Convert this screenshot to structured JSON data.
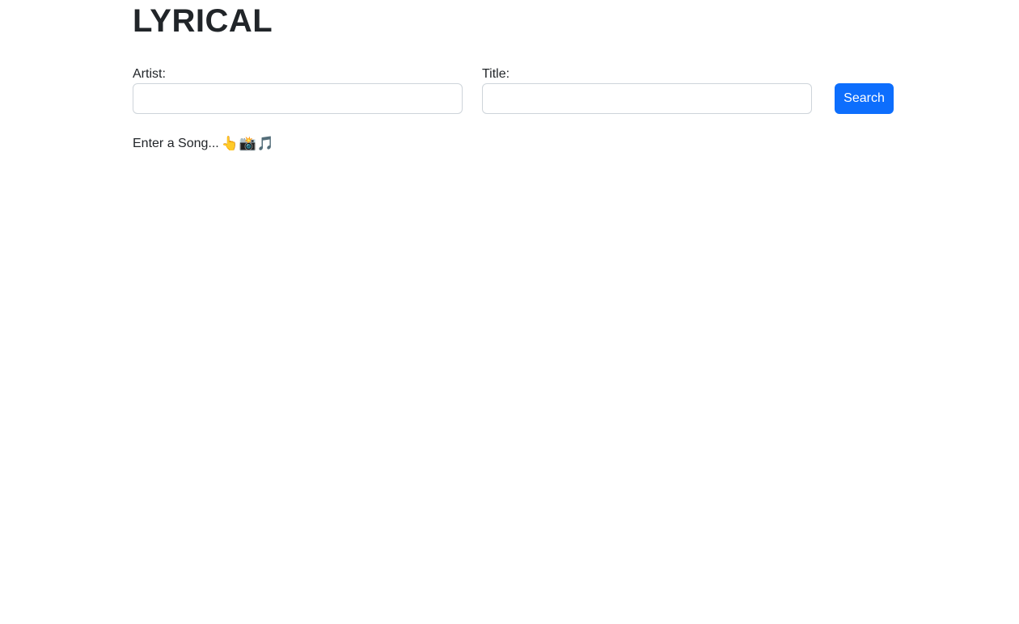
{
  "header": {
    "title": "LYRICAL"
  },
  "form": {
    "artist_label": "Artist:",
    "artist_value": "",
    "artist_placeholder": "",
    "title_label": "Title:",
    "title_value": "",
    "title_placeholder": "",
    "search_label": "Search"
  },
  "status": {
    "prompt_text": "Enter a Song...",
    "emojis": {
      "pointing": "👆",
      "camera": "📸",
      "music": "🎵"
    }
  },
  "colors": {
    "accent": "#0d6efd",
    "text": "#212529",
    "input_border": "#ced4da",
    "background": "#ffffff"
  },
  "icons": [
    "pointing-hand-icon",
    "camera-flash-icon",
    "music-notes-icon"
  ]
}
